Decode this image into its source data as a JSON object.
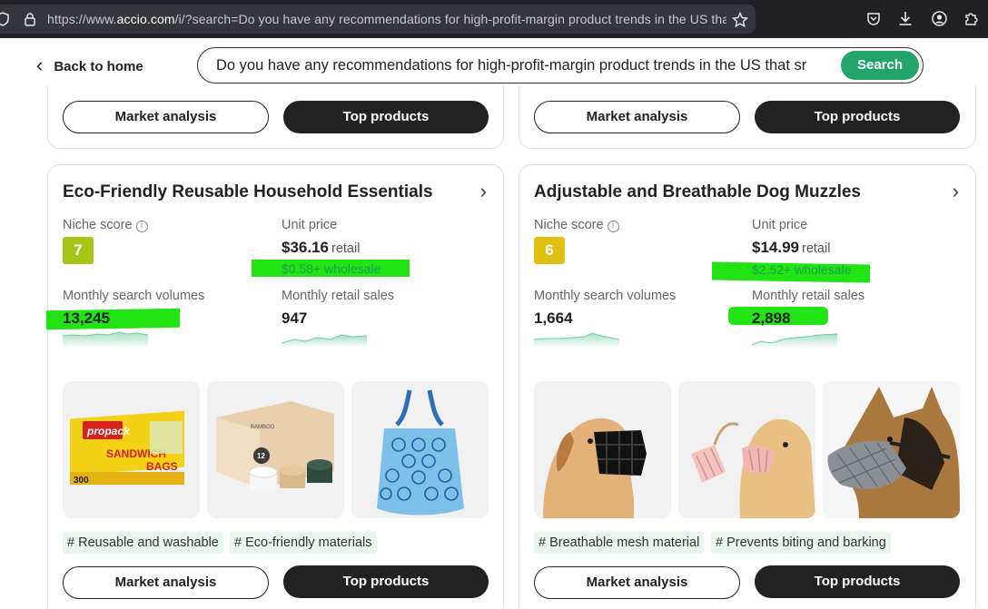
{
  "browser": {
    "url_prefix": "https://www.",
    "url_domain": "accio.com",
    "url_suffix": "/i/?search=Do you have any recommendations for high-profit-margin product trends in the US that"
  },
  "header": {
    "back_label": "Back to home",
    "search_value": "Do you have any recommendations for high-profit-margin product trends in the US that sr",
    "search_button": "Search"
  },
  "top_cards": [
    {
      "market_label": "Market analysis",
      "top_label": "Top products"
    },
    {
      "market_label": "Market analysis",
      "top_label": "Top products"
    }
  ],
  "products": [
    {
      "title": "Eco-Friendly Reusable Household Essentials",
      "niche_label": "Niche score",
      "niche_score": "7",
      "score_color": "#a8c617",
      "unit_price_label": "Unit price",
      "retail_price": "$36.16",
      "retail_word": "retail",
      "wholesale": "$0.58+ wholesale",
      "search_label": "Monthly search volumes",
      "search_volume": "13,245",
      "sales_label": "Monthly retail sales",
      "retail_sales": "947",
      "images": [
        "sandwich-bags",
        "toilet-paper-box",
        "reusable-tote-bag"
      ],
      "tags": [
        "# Reusable and washable",
        "# Eco-friendly materials"
      ],
      "market_label": "Market analysis",
      "top_label": "Top products"
    },
    {
      "title": "Adjustable and Breathable Dog Muzzles",
      "niche_label": "Niche score",
      "niche_score": "6",
      "score_color": "#e0c010",
      "unit_price_label": "Unit price",
      "retail_price": "$14.99",
      "retail_word": "retail",
      "wholesale": "$2.52+ wholesale",
      "search_label": "Monthly search volumes",
      "search_volume": "1,664",
      "sales_label": "Monthly retail sales",
      "retail_sales": "2,898",
      "images": [
        "dog-black-muzzle",
        "dog-pink-muzzle",
        "shepherd-mesh-muzzle"
      ],
      "tags": [
        "# Breathable mesh material",
        "# Prevents biting and barking"
      ],
      "market_label": "Market analysis",
      "top_label": "Top products"
    }
  ]
}
